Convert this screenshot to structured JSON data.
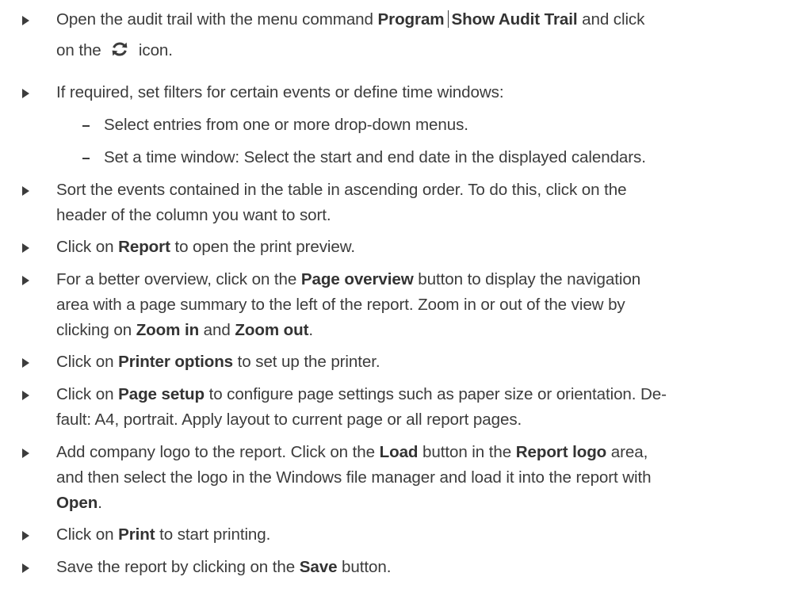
{
  "steps": [
    {
      "a": "Open the audit trail with the menu command ",
      "b1": "Program",
      "b2": "Show Audit Trail",
      "c": " and click",
      "d": "on the ",
      "icon": "refresh-icon",
      "e": " icon."
    },
    {
      "text": "If required, set filters for certain events or define time windows:"
    },
    {
      "text": "Select entries from one or more drop-down menus."
    },
    {
      "text": "Set a time window: Select the start and end date in the displayed calendars."
    },
    {
      "text1": "Sort the events contained in the table in ascending order. To do this, click on the",
      "text2": "header of the column you want to sort."
    },
    {
      "a": "Click on ",
      "b": "Report",
      "c": " to open the print preview."
    },
    {
      "a": "For a better overview, click on the ",
      "b": "Page overview",
      "c": " button to display the navigation",
      "d": "area with a page summary to the left of the report. Zoom in or out of the view by",
      "e": "clicking on ",
      "f": "Zoom in",
      "g": " and ",
      "h": "Zoom out",
      "i": "."
    },
    {
      "a": "Click on ",
      "b": "Printer options",
      "c": " to set up the printer."
    },
    {
      "a": "Click on ",
      "b": "Page setup",
      "c": " to configure page settings such as paper size or orientation. De-",
      "d": "fault: A4, portrait. Apply layout to current page or all report pages."
    },
    {
      "a": "Add company logo to the report. Click on the ",
      "b": "Load",
      "c": " button in the ",
      "d": "Report logo",
      "e": " area,",
      "f": "and then select the logo in the Windows file manager and load it into the report with",
      "g": "Open",
      "h": "."
    },
    {
      "a": "Click on ",
      "b": "Print",
      "c": " to start printing."
    },
    {
      "a": "Save the report by clicking on the ",
      "b": "Save",
      "c": " button."
    }
  ]
}
